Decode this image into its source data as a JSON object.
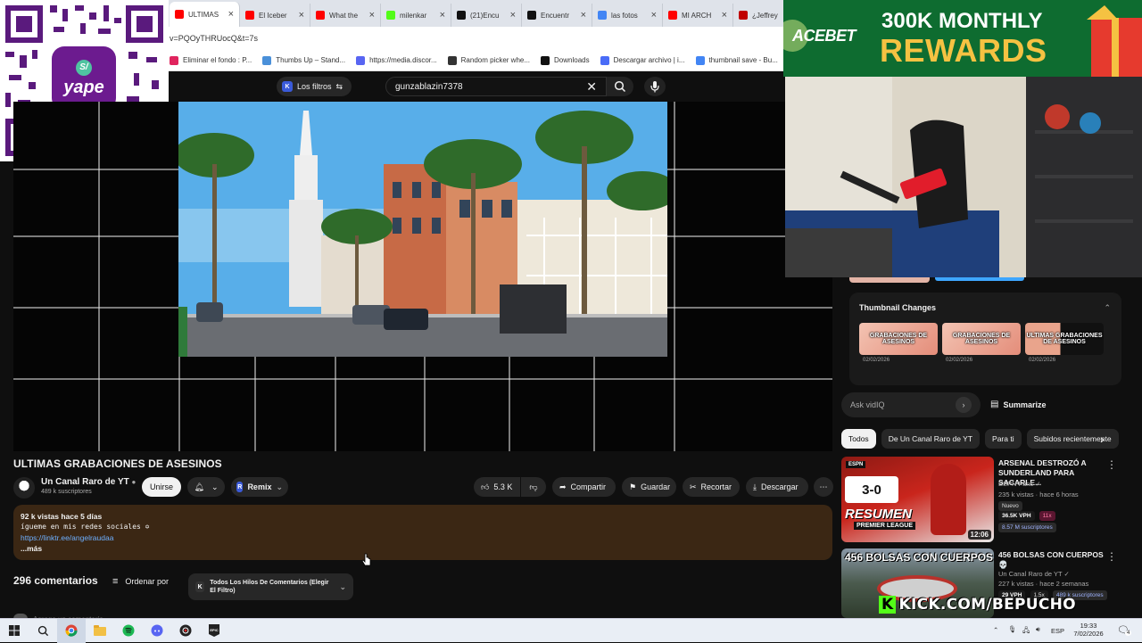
{
  "browser": {
    "tabs": [
      {
        "label": "ULTIMAS",
        "favicon_color": "#ff0000",
        "active": true
      },
      {
        "label": "El Iceber",
        "favicon_color": "#ff0000"
      },
      {
        "label": "What the",
        "favicon_color": "#ff0000"
      },
      {
        "label": "milenkar",
        "favicon_color": "#53fc18"
      },
      {
        "label": "(21)Encu",
        "favicon_color": "#111111"
      },
      {
        "label": "Encuentr",
        "favicon_color": "#111111"
      },
      {
        "label": "las fotos",
        "favicon_color": "#4285f4"
      },
      {
        "label": "MI ARCH",
        "favicon_color": "#ff0000"
      },
      {
        "label": "¿Jeffrey",
        "favicon_color": "#c00000"
      }
    ],
    "address": "v=PQOyTHRUocQ&t=7s",
    "bookmarks": [
      {
        "label": "Eliminar el fondo : P...",
        "color": "#e0245e"
      },
      {
        "label": "Thumbs Up – Stand...",
        "color": "#4a90d9"
      },
      {
        "label": "https://media.discor...",
        "color": "#5865f2"
      },
      {
        "label": "Random picker whe...",
        "color": "#333333"
      },
      {
        "label": "Downloads",
        "color": "#111111"
      },
      {
        "label": "Descargar archivo | i...",
        "color": "#4a6cf7"
      },
      {
        "label": "thumbnail save - Bu...",
        "color": "#4285f4"
      }
    ]
  },
  "overlays": {
    "qr_brand": "yape",
    "acebet_logo": "ACEBET",
    "acebet_line1": "300K MONTHLY",
    "acebet_line2": "REWARDS",
    "kick_url": "KICK.COM/BEPUCHO"
  },
  "youtube": {
    "filters_label": "Los filtros",
    "search_value": "gunzablazin7378",
    "video": {
      "title": "ULTIMAS GRABACIONES DE ASESINOS",
      "channel": "Un Canal Raro de YT",
      "subscribers": "489 k suscriptores",
      "join_label": "Unirse",
      "remix_label": "Remix",
      "likes": "5.3 K",
      "share_label": "Compartir",
      "save_label": "Guardar",
      "clip_label": "Recortar",
      "download_label": "Descargar"
    },
    "description": {
      "views_date": "92 k vistas  hace 5 días",
      "line": "ígueme en mis redes sociales ✡︎",
      "link": "https://linktr.ee/angelraudaa",
      "more": "...más"
    },
    "comments": {
      "count": "296 comentarios",
      "sort_label": "Ordenar por",
      "thread_filter": "Todos Los Hilos De Comentarios (Elegir El Filtro)",
      "add_placeholder": "Agrega un comentario..."
    },
    "thumbnail_changes": {
      "title": "Thumbnail Changes",
      "items": [
        {
          "text": "GRABACIONES DE ASESINOS",
          "date": "02/02/2026"
        },
        {
          "text": "GRABACIONES DE ASESINOS",
          "date": "02/02/2026"
        },
        {
          "text": "ULTIMAS GRABACIONES DE ASESINOS",
          "date": "02/02/2026"
        }
      ]
    },
    "ask_placeholder": "Ask vidIQ",
    "summarize_label": "Summarize",
    "chips": [
      "Todos",
      "De Un Canal Raro de YT",
      "Para ti",
      "Subidos recientemente"
    ],
    "recommendations": [
      {
        "title": "ARSENAL DESTROZÓ A SUNDERLAND PARA SACARLE...",
        "channel": "ESPN Fans",
        "meta": "235 k vistas · hace 6 horas",
        "badge": "Nuevo",
        "vph": "36.5K VPH",
        "mult": "11x",
        "subs": "8.57 M suscriptores",
        "duration": "12:06",
        "thumb_text": "RESUMEN",
        "thumb_sub": "PREMIER LEAGUE",
        "score": "3-0"
      },
      {
        "title": "456 BOLSAS CON CUERPOS 💀",
        "channel": "Un Canal Raro de YT",
        "meta": "227 k vistas · hace 2 semanas",
        "vph": "29 VPH",
        "mult": "1.5x",
        "subs": "489 k suscriptores",
        "thumb_text": "456 BOLSAS CON CUERPOS"
      }
    ]
  },
  "taskbar": {
    "language": "ESP",
    "time": "19:33",
    "date": "7/02/2026",
    "notifications": "4"
  }
}
